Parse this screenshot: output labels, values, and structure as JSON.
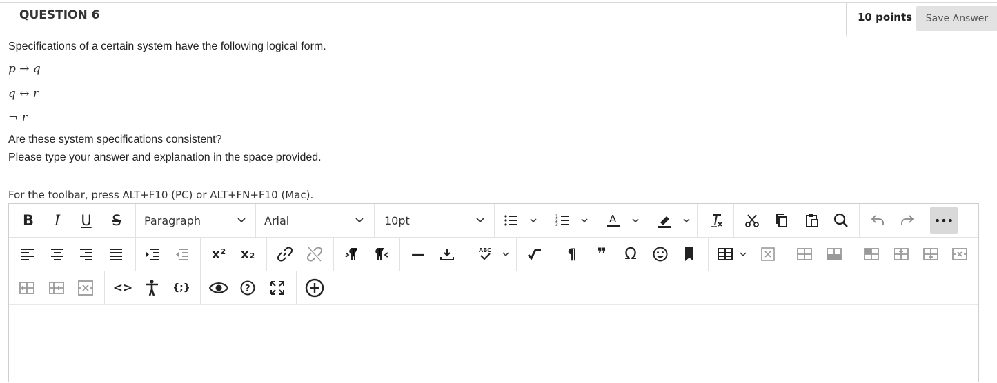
{
  "question": {
    "title": "QUESTION 6",
    "points": "10 points",
    "save_label": "Save Answer",
    "intro": "Specifications of a certain system have the following logical form.",
    "formulas": [
      "p → q",
      "q ↔ r",
      "¬ r"
    ],
    "prompt1": "Are these system specifications consistent?",
    "prompt2": "Please type your answer and explanation in the space provided."
  },
  "editor": {
    "hint": "For the toolbar, press ALT+F10 (PC) or ALT+FN+F10 (Mac).",
    "format_select": "Paragraph",
    "font_select": "Arial",
    "size_select": "10pt",
    "glyphs": {
      "bold": "B",
      "italic": "I",
      "underline": "U",
      "strike": "S",
      "superscript": "x²",
      "subscript": "x₂",
      "hr": "—",
      "nbsp": "¶",
      "quote": "❞",
      "omega": "Ω",
      "more": "•••",
      "code": "<>",
      "code_sample": "{;}"
    },
    "icons": [
      "bold-icon",
      "italic-icon",
      "underline-icon",
      "strikethrough-icon",
      "bullet-list-icon",
      "numbered-list-icon",
      "text-color-icon",
      "highlight-icon",
      "clear-format-icon",
      "cut-icon",
      "copy-icon",
      "paste-icon",
      "search-icon",
      "undo-icon",
      "redo-icon",
      "more-icon",
      "align-left-icon",
      "align-center-icon",
      "align-right-icon",
      "justify-icon",
      "indent-icon",
      "outdent-icon",
      "superscript-icon",
      "subscript-icon",
      "link-icon",
      "unlink-icon",
      "ltr-icon",
      "rtl-icon",
      "horizontal-line-icon",
      "anchor-icon",
      "spellcheck-icon",
      "math-icon",
      "paragraph-mark-icon",
      "blockquote-icon",
      "omega-icon",
      "emoji-icon",
      "bookmark-icon",
      "table-icon",
      "table-delete-icon",
      "row-before-icon",
      "row-after-icon",
      "col-before-icon",
      "col-after-icon",
      "col-insert-icon",
      "col-delete-icon",
      "accessibility-icon",
      "code-icon",
      "code-sample-icon",
      "preview-icon",
      "help-icon",
      "fullscreen-icon",
      "add-content-icon"
    ]
  },
  "colors": {
    "accent": "#e2e2e2",
    "border": "#cfcfcf",
    "text": "#222222",
    "dim_icon": "#9a9a9a"
  }
}
